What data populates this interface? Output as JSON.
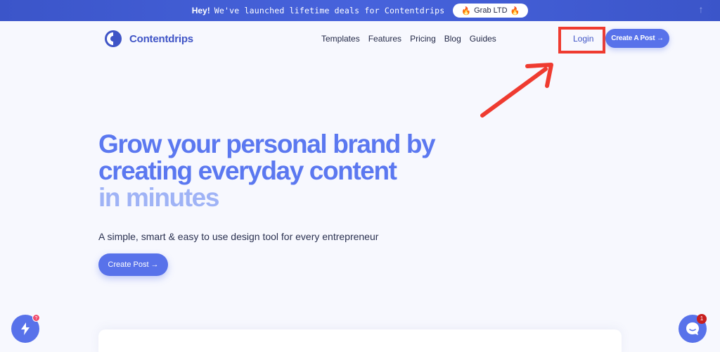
{
  "announcement": {
    "hey": "Hey!",
    "message": "We've launched lifetime deals for Contentdrips",
    "cta_label": "Grab LTD",
    "cta_icon": "fire-icon"
  },
  "brand": {
    "name": "Contentdrips",
    "color": "#3f54c6"
  },
  "nav": {
    "items": [
      "Templates",
      "Features",
      "Pricing",
      "Blog",
      "Guides"
    ],
    "login_label": "Login",
    "create_label": "Create A Post →"
  },
  "hero": {
    "title_line1": "Grow your personal brand by",
    "title_line2": "creating everyday content",
    "title_line3": "in minutes",
    "subtitle": "A simple, smart & easy to use design tool for every entrepreneur",
    "cta_label": "Create Post →"
  },
  "widgets": {
    "bolt_badge": "?",
    "chat_badge": "1"
  },
  "colors": {
    "primary": "#5872ea",
    "annotation": "#ef3b30",
    "hero_light": "#9fb3f6"
  }
}
